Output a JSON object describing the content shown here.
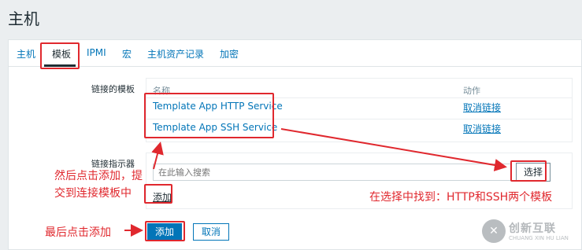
{
  "page_title": "主机",
  "tabs": [
    {
      "label": "主机"
    },
    {
      "label": "模板"
    },
    {
      "label": "IPMI"
    },
    {
      "label": "宏"
    },
    {
      "label": "主机资产记录"
    },
    {
      "label": "加密"
    }
  ],
  "linked_templates": {
    "label": "链接的模板",
    "col_name": "名称",
    "col_action": "动作",
    "rows": [
      {
        "name": "Template App HTTP Service",
        "action": "取消链接"
      },
      {
        "name": "Template App SSH Service",
        "action": "取消链接"
      }
    ]
  },
  "link_indicator": {
    "label": "链接指示器",
    "placeholder": "在此输入搜索",
    "select_label": "选择",
    "add_label": "添加"
  },
  "form_buttons": {
    "add": "添加",
    "cancel": "取消"
  },
  "annotations": {
    "note_add_line1": "然后点击添加，提",
    "note_add_line2": "交到连接模板中",
    "note_select": "在选择中找到：HTTP和SSH两个模板",
    "note_submit": "最后点击添加",
    "color": "#e0282e"
  },
  "watermark": {
    "title": "创新互联",
    "subtitle": "CHUANG XIN HU LIAN"
  }
}
